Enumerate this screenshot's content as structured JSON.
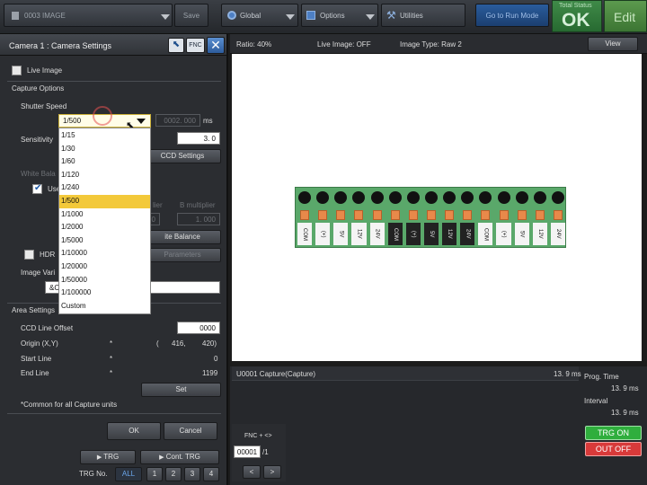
{
  "topbar": {
    "program": "0003  IMAGE",
    "save": "Save",
    "global": "Global",
    "options": "Options",
    "utilities": "Utilities",
    "go_run": "Go to Run Mode",
    "total_status_label": "Total Status",
    "total_status_value": "OK",
    "edit": "Edit"
  },
  "panel": {
    "title": "Camera  1  : Camera Settings",
    "fnc": "FNC",
    "live_image": "Live Image",
    "capture_options": "Capture Options",
    "shutter_speed": "Shutter Speed",
    "shutter_value": "1/500",
    "shutter_time": "0002. 000",
    "shutter_unit": "ms",
    "sensitivity": "Sensitivity",
    "sensitivity_value": "3. 0",
    "ccd_settings": "CCD Settings",
    "white_balance": "White Bala",
    "use": "Use",
    "r_multiplier_partial": "lier",
    "b_multiplier": "B  multiplier",
    "r_value_partial": "0",
    "b_value": "1. 000",
    "white_balance_btn": "ite Balance",
    "hdr": "HDR",
    "parameters": "Parameters",
    "image_variation": "Image Vari",
    "image_field": "&C",
    "area_settings": "Area Settings",
    "ccd_line_offset": "CCD  Line  Offset",
    "ccd_line_offset_value": "0000",
    "origin": "Origin  (X,Y)",
    "origin_value_open": "(",
    "origin_x": "416,",
    "origin_y": "420)",
    "start_line": "Start  Line",
    "start_line_value": "0",
    "end_line": "End  Line",
    "end_line_value": "1199",
    "colon": "*",
    "set": "Set",
    "note": "*Common  for  all  Capture  units",
    "ok": "OK",
    "cancel": "Cancel",
    "trg": "TRG",
    "cont_trg": "Cont. TRG",
    "trg_no": "TRG  No.",
    "trg_all": "ALL",
    "trg_nums": [
      "1",
      "2",
      "3",
      "4"
    ]
  },
  "dropdown": {
    "options": [
      "1/15",
      "1/30",
      "1/60",
      "1/120",
      "1/240",
      "1/500",
      "1/1000",
      "1/2000",
      "1/5000",
      "1/10000",
      "1/20000",
      "1/50000",
      "1/100000",
      "Custom"
    ],
    "selected_index": 5
  },
  "infobar": {
    "ratio": "Ratio:  40%",
    "live": "Live  Image:  OFF",
    "image_type": "Image  Type:  Raw  2",
    "view": "View"
  },
  "board": {
    "labels": [
      "COM",
      "(+)",
      "5V",
      "12V",
      "24V",
      "COM",
      "(+)",
      "5V",
      "12V",
      "24V",
      "COM",
      "(+)",
      "5V",
      "12V",
      "24V"
    ]
  },
  "result": {
    "unit": "U0001  Capture(Capture)",
    "unit_time": "13. 9 ms",
    "prog_time_label": "Prog.  Time",
    "prog_time_value": "13. 9 ms",
    "interval_label": "Interval",
    "interval_value": "13. 9 ms",
    "fnc_nav": "FNC  +  <>",
    "page_value": "00001",
    "page_total": "/1",
    "prev": "<",
    "next": ">",
    "trg_on": "TRG ON",
    "out_off": "OUT OFF"
  },
  "colors": {
    "accent_blue": "#1e4f8c",
    "ok_green": "#2f7d3a",
    "edit_green": "#4c8a3f",
    "trg_on": "#2fae3d",
    "out_off": "#d83a3a",
    "board_green": "#5aa86a",
    "terminal_orange": "#e8894a"
  }
}
